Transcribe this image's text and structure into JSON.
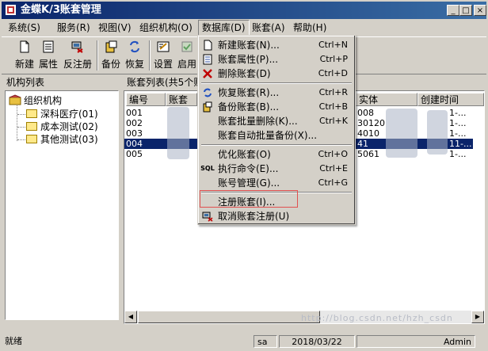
{
  "window": {
    "title": "金蝶K/3账套管理"
  },
  "titlebar_buttons": {
    "minimize": "_",
    "maximize": "□",
    "close": "×"
  },
  "menubar": [
    {
      "label": "系统(S)"
    },
    {
      "label": "服务(R)"
    },
    {
      "label": "视图(V)"
    },
    {
      "label": "组织机构(O)"
    },
    {
      "label": "数据库(D)"
    },
    {
      "label": "账套(A)"
    },
    {
      "label": "帮助(H)"
    }
  ],
  "toolbar": [
    {
      "label": "新建",
      "icon": "new-doc-icon"
    },
    {
      "label": "属性",
      "icon": "properties-icon"
    },
    {
      "label": "反注册",
      "icon": "unregister-icon"
    },
    {
      "label": "备份",
      "icon": "backup-icon"
    },
    {
      "label": "恢复",
      "icon": "restore-icon"
    },
    {
      "label": "设置",
      "icon": "settings-icon"
    },
    {
      "label": "启用",
      "icon": "enable-icon"
    }
  ],
  "left_panel": {
    "title": "机构列表",
    "root": "组织机构",
    "children": [
      "深科医疗(01)",
      "成本测试(02)",
      "其他测试(03)"
    ]
  },
  "right_panel": {
    "title": "账套列表(共5个账",
    "columns": [
      "编号",
      "账套",
      "实体",
      "创建时间"
    ],
    "rows": [
      {
        "id": "001",
        "entity": "008",
        "created": "1-..."
      },
      {
        "id": "002",
        "entity": "30120",
        "created": "1-..."
      },
      {
        "id": "003",
        "entity": "4010",
        "created": "1-..."
      },
      {
        "id": "004",
        "entity": "41",
        "created": "11-...",
        "selected": true
      },
      {
        "id": "005",
        "entity": "5061",
        "created": "1-..."
      }
    ]
  },
  "dropdown": {
    "items": [
      {
        "type": "item",
        "label": "新建账套(N)...",
        "shortcut": "Ctrl+N",
        "icon": "new-doc-icon"
      },
      {
        "type": "item",
        "label": "账套属性(P)...",
        "shortcut": "Ctrl+P",
        "icon": "properties-icon"
      },
      {
        "type": "item",
        "label": "删除账套(D)",
        "shortcut": "Ctrl+D",
        "icon": "delete-x-icon"
      },
      {
        "type": "sep"
      },
      {
        "type": "item",
        "label": "恢复账套(R)...",
        "shortcut": "Ctrl+R",
        "icon": "restore-icon"
      },
      {
        "type": "item",
        "label": "备份账套(B)...",
        "shortcut": "Ctrl+B",
        "icon": "backup-icon"
      },
      {
        "type": "item",
        "label": "账套批量删除(K)...",
        "shortcut": "Ctrl+K",
        "icon": ""
      },
      {
        "type": "item",
        "label": "账套自动批量备份(X)...",
        "shortcut": "",
        "icon": ""
      },
      {
        "type": "sep"
      },
      {
        "type": "item",
        "label": "优化账套(O)",
        "shortcut": "Ctrl+O",
        "icon": ""
      },
      {
        "type": "item",
        "label": "执行命令(E)...",
        "shortcut": "Ctrl+E",
        "icon": "sql-icon"
      },
      {
        "type": "item",
        "label": "账号管理(G)...",
        "shortcut": "Ctrl+G",
        "icon": ""
      },
      {
        "type": "sep"
      },
      {
        "type": "item",
        "label": "注册账套(I)...",
        "shortcut": "",
        "icon": ""
      },
      {
        "type": "item",
        "label": "取消账套注册(U)",
        "shortcut": "",
        "icon": "unregister-icon"
      }
    ],
    "sql_icon_text": "SQL"
  },
  "statusbar": {
    "message": "就绪",
    "user": "sa",
    "date": "2018/03/22",
    "role": "Admin"
  },
  "watermark": "http://blog.csdn.net/hzh_csdn",
  "colors": {
    "title_start": "#0a246a",
    "title_end": "#3a6ea5",
    "selection": "#0a246a",
    "highlight_box": "#e05050"
  }
}
